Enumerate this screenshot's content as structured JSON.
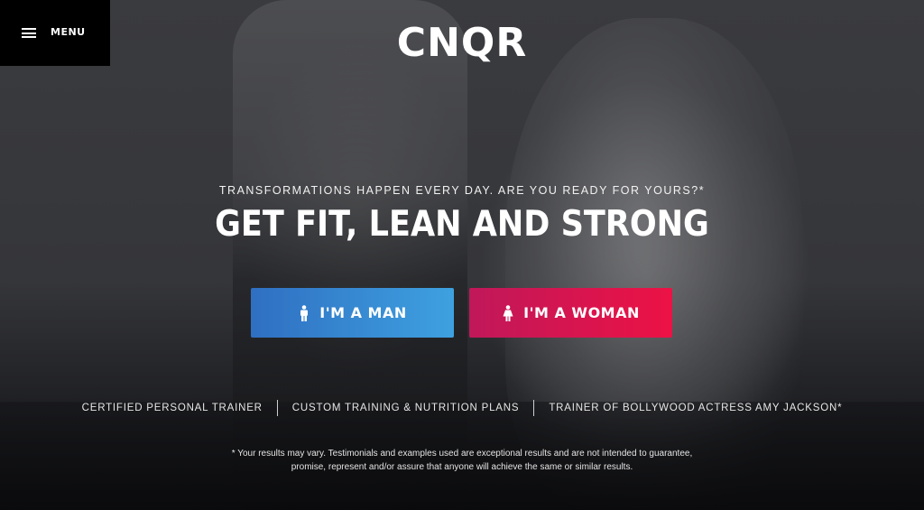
{
  "header": {
    "menu_label": "MENU",
    "logo": "CNQR"
  },
  "hero": {
    "tagline": "TRANSFORMATIONS HAPPEN EVERY DAY. ARE YOU READY FOR YOURS?*",
    "headline": "GET FIT, LEAN AND STRONG",
    "cta_man": {
      "label": "I'M A MAN",
      "icon": "male-figure-icon",
      "color_start": "#2f6fc2",
      "color_end": "#3ea1e0"
    },
    "cta_woman": {
      "label": "I'M A WOMAN",
      "icon": "female-figure-icon",
      "color_start": "#c0185a",
      "color_end": "#ec1245"
    }
  },
  "features": [
    "CERTIFIED PERSONAL TRAINER",
    "CUSTOM TRAINING & NUTRITION PLANS",
    "TRAINER OF BOLLYWOOD ACTRESS AMY JACKSON*"
  ],
  "disclaimer": {
    "line1": "* Your results may vary. Testimonials and examples used are exceptional results and are not intended to guarantee,",
    "line2": "promise, represent and/or assure that anyone will achieve the same or similar results."
  }
}
